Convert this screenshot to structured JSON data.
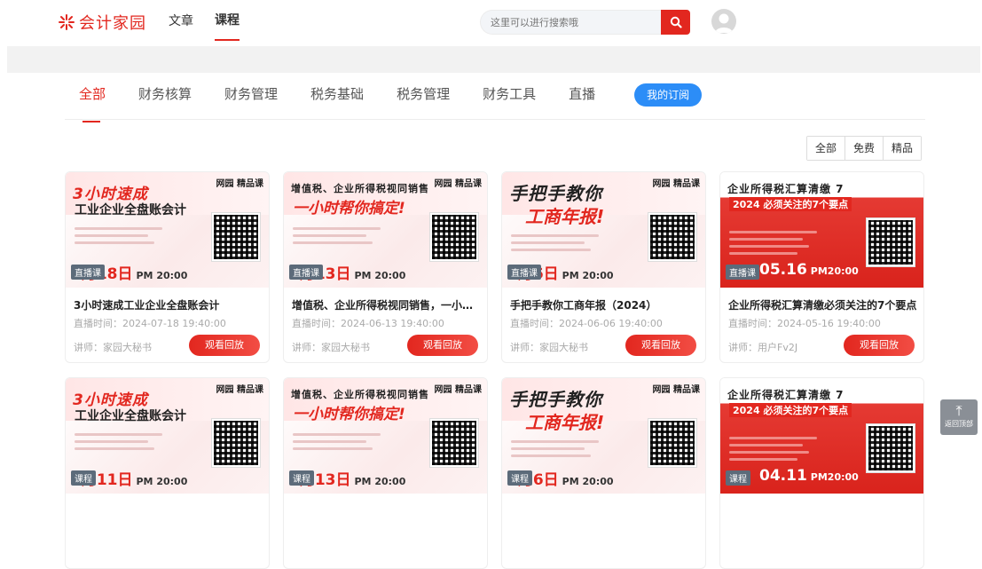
{
  "header": {
    "logo_text": "会计家园",
    "nav": [
      "文章",
      "课程"
    ],
    "search_placeholder": "这里可以进行搜索哦"
  },
  "tabs": {
    "categories": [
      "全部",
      "财务核算",
      "财务管理",
      "税务基础",
      "税务管理",
      "财务工具",
      "直播"
    ],
    "subscribe_label": "我的订阅"
  },
  "filters": [
    "全部",
    "免费",
    "精品"
  ],
  "brand_label": "网园 精品课",
  "courses": [
    {
      "head": "3小时速成",
      "sub": "工业企业全盘账会计",
      "tag": "直播课",
      "date": "7月18日",
      "pm": "PM 20:00",
      "title": "3小时速成工业企业全盘账会计",
      "time": "直播时间：2024-07-18 19:40:00",
      "lecturer": "讲师：家园大秘书",
      "button": "观看回放",
      "style": "light"
    },
    {
      "head": "增值税、企业所得税视同销售",
      "sub": "一小时帮你搞定!",
      "tag": "直播课",
      "date": "6月13日",
      "pm": "PM 20:00",
      "title": "增值税、企业所得税视同销售，一小时帮你搞定！",
      "time": "直播时间：2024-06-13 19:40:00",
      "lecturer": "讲师：家园大秘书",
      "button": "观看回放",
      "style": "light"
    },
    {
      "head": "手把手教你",
      "sub": "工商年报!",
      "tag": "直播课",
      "date": "6月6日",
      "pm": "PM 20:00",
      "title": "手把手教你工商年报（2024）",
      "time": "直播时间：2024-06-06 19:40:00",
      "lecturer": "讲师：家园大秘书",
      "button": "观看回放",
      "style": "light"
    },
    {
      "head": "企业所得税汇算清缴 7",
      "sub": "2024 必须关注的7个要点",
      "tag": "直播课",
      "date": "05.16",
      "pm": "PM20:00",
      "title": "企业所得税汇算清缴必须关注的7个要点",
      "time": "直播时间：2024-05-16 19:40:00",
      "lecturer": "讲师：用户Fv2J",
      "button": "观看回放",
      "style": "red"
    },
    {
      "head": "3小时速成",
      "sub": "工业企业全盘账会计",
      "tag": "课程",
      "date": "7月11日",
      "pm": "PM 20:00",
      "title": "",
      "time": "",
      "lecturer": "",
      "button": "",
      "style": "light"
    },
    {
      "head": "增值税、企业所得税视同销售",
      "sub": "一小时帮你搞定!",
      "tag": "课程",
      "date": "6月13日",
      "pm": "PM 20:00",
      "title": "",
      "time": "",
      "lecturer": "",
      "button": "",
      "style": "light"
    },
    {
      "head": "手把手教你",
      "sub": "工商年报!",
      "tag": "课程",
      "date": "6月6日",
      "pm": "PM 20:00",
      "title": "",
      "time": "",
      "lecturer": "",
      "button": "",
      "style": "light"
    },
    {
      "head": "企业所得税汇算清缴 7",
      "sub": "2024 必须关注的7个要点",
      "tag": "课程",
      "date": "04.11",
      "pm": "PM20:00",
      "title": "",
      "time": "",
      "lecturer": "",
      "button": "",
      "style": "red"
    }
  ],
  "backtop_label": "返回顶部"
}
